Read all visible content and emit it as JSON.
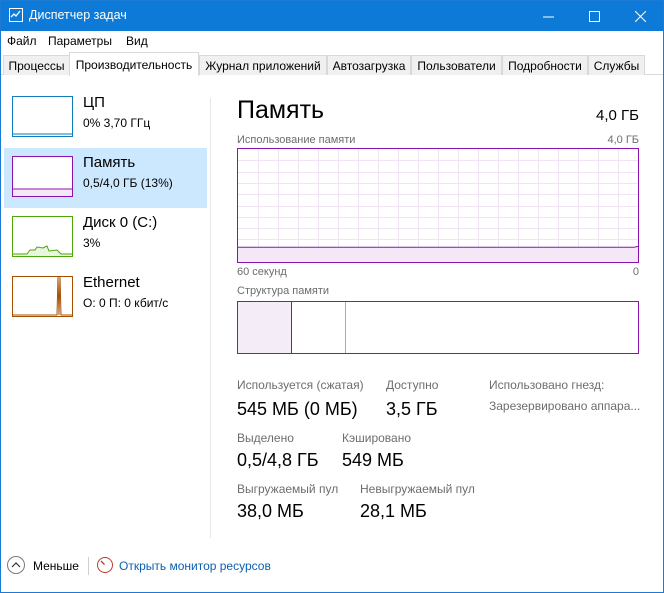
{
  "window": {
    "title": "Диспетчер задач"
  },
  "menu": [
    "Файл",
    "Параметры",
    "Вид"
  ],
  "tabs": [
    {
      "label": "Процессы"
    },
    {
      "label": "Производительность",
      "active": true
    },
    {
      "label": "Журнал приложений"
    },
    {
      "label": "Автозагрузка"
    },
    {
      "label": "Пользователи"
    },
    {
      "label": "Подробности"
    },
    {
      "label": "Службы"
    }
  ],
  "sidebar": {
    "items": [
      {
        "name": "ЦП",
        "detail": "0% 3,70 ГГц",
        "color": "#117dbb"
      },
      {
        "name": "Память",
        "detail": "0,5/4,0 ГБ (13%)",
        "color": "#8b12ae",
        "selected": true
      },
      {
        "name": "Диск 0 (C:)",
        "detail": "3%",
        "color": "#4da60c"
      },
      {
        "name": "Ethernet",
        "detail": "О: 0 П: 0 кбит/с",
        "color": "#a74f01"
      }
    ]
  },
  "memory": {
    "title": "Память",
    "total": "4,0 ГБ",
    "usage_label": "Использование памяти",
    "usage_max": "4,0 ГБ",
    "axis_left": "60 секунд",
    "axis_right": "0",
    "composition_label": "Структура памяти",
    "usage_fraction": 0.13,
    "stats": {
      "in_use_label": "Используется (сжатая)",
      "in_use_value": "545 МБ (0 МБ)",
      "available_label": "Доступно",
      "available_value": "3,5 ГБ",
      "slots_label": "Использовано гнезд:",
      "reserved_label": "Зарезервировано аппара...",
      "committed_label": "Выделено",
      "committed_value": "0,5/4,8 ГБ",
      "cached_label": "Кэшировано",
      "cached_value": "549 МБ",
      "paged_label": "Выгружаемый пул",
      "paged_value": "38,0 МБ",
      "nonpaged_label": "Невыгружаемый пул",
      "nonpaged_value": "28,1 МБ"
    }
  },
  "footer": {
    "fewer_label": "Меньше",
    "monitor_label": "Открыть монитор ресурсов"
  },
  "colors": {
    "titlebar": "#0c7ad6",
    "memory": "#8b12ae",
    "selection": "#cce8ff",
    "link": "#0a5fb0"
  }
}
